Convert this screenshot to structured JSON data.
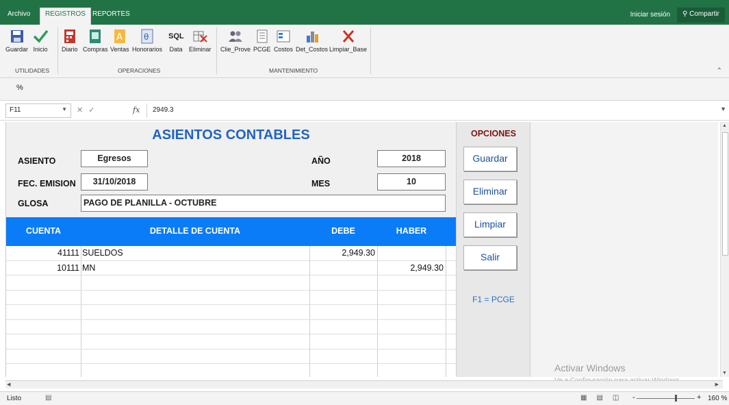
{
  "tabs": {
    "archivo": "Archivo",
    "registros": "REGISTROS",
    "reportes": "REPORTES"
  },
  "account": {
    "signin": "Iniciar sesión",
    "share": "Compartir"
  },
  "ribbon": {
    "utilidades": {
      "label": "UTILIDADES",
      "buttons": [
        "Guardar",
        "Inicio"
      ]
    },
    "operaciones": {
      "label": "OPERACIONES",
      "buttons": [
        "Diario",
        "Compras",
        "Ventas",
        "Honorarios",
        "Data",
        "Eliminar"
      ]
    },
    "mantenimiento": {
      "label": "MANTENIMIENTO",
      "buttons": [
        "Clie_Prove",
        "PCGE",
        "Costos",
        "Det_Costos",
        "Limpiar_Base"
      ]
    },
    "sql_text": "SQL"
  },
  "quick_access": {
    "percent": "%"
  },
  "formula_bar": {
    "name_box": "F11",
    "fx": "fx",
    "value": "2949.3"
  },
  "form": {
    "title": "ASIENTOS CONTABLES",
    "asiento_label": "ASIENTO",
    "asiento_value": "Egresos",
    "fec_label": "FEC. EMISION",
    "fec_value": "31/10/2018",
    "glosa_label": "GLOSA",
    "glosa_value": "PAGO DE PLANILLA - OCTUBRE",
    "anio_label": "AÑO",
    "anio_value": "2018",
    "mes_label": "MES",
    "mes_value": "10"
  },
  "grid": {
    "headers": [
      "CUENTA",
      "DETALLE DE CUENTA",
      "DEBE",
      "HABER"
    ],
    "rows": [
      {
        "cuenta": "41111",
        "detalle": "SUELDOS",
        "debe": "2,949.30",
        "haber": ""
      },
      {
        "cuenta": "10111",
        "detalle": "MN",
        "debe": "",
        "haber": "2,949.30"
      }
    ]
  },
  "options": {
    "title": "OPCIONES",
    "guardar": "Guardar",
    "eliminar": "Eliminar",
    "limpiar": "Limpiar",
    "salir": "Salir",
    "hint": "F1 = PCGE"
  },
  "watermark": {
    "line1": "Activar Windows",
    "line2": "Ve a Configuración para activar Windows."
  },
  "status": {
    "ready": "Listo",
    "zoom": "160 %"
  },
  "icons": [
    "save-icon",
    "check-icon",
    "diario-icon",
    "compras-icon",
    "ventas-icon",
    "honorarios-icon",
    "sql-icon",
    "delete-table-icon",
    "users-icon",
    "pcge-icon",
    "costos-icon",
    "det-costos-icon",
    "clear-x-icon"
  ],
  "colors": {
    "excel_green": "#217346",
    "header_blue": "#0b7cf8",
    "title_blue": "#1f63c5",
    "options_title": "#7a1414"
  }
}
